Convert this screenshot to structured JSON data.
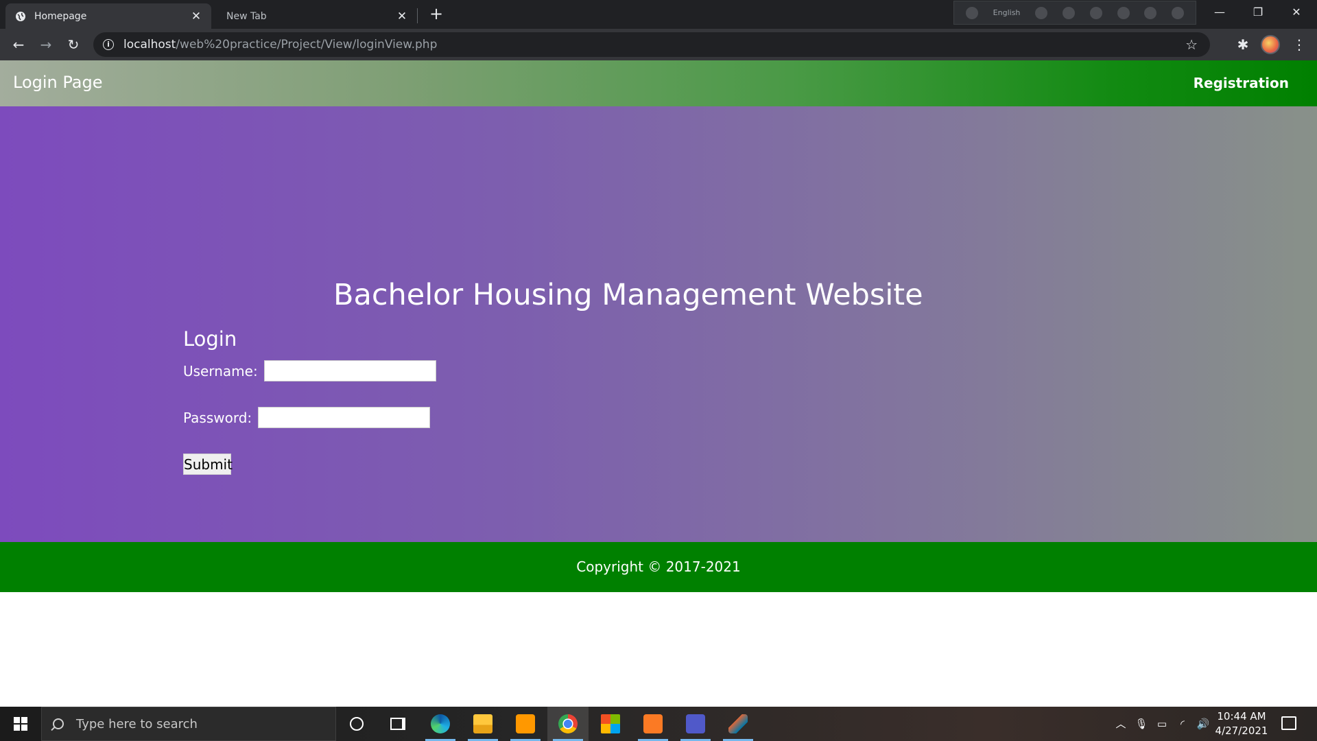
{
  "browser": {
    "tabs": [
      {
        "title": "Homepage",
        "active": true
      },
      {
        "title": "New Tab",
        "active": false
      }
    ],
    "extension_strip": {
      "language": "English"
    },
    "address": {
      "host": "localhost",
      "path": "/web%20practice/Project/View/loginView.php"
    }
  },
  "header": {
    "brand": "Login Page",
    "registration_link": "Registration"
  },
  "main": {
    "site_title": "Bachelor Housing Management Website",
    "login_heading": "Login",
    "username_label": "Username:",
    "username_value": "",
    "password_label": "Password:",
    "password_value": "",
    "submit_label": "Submit"
  },
  "footer": {
    "copyright": "Copyright © 2017-2021"
  },
  "taskbar": {
    "search_placeholder": "Type here to search",
    "time": "10:44 AM",
    "date": "4/27/2021",
    "apps": [
      "cortana",
      "task-view",
      "edge",
      "file-explorer",
      "sublime-text",
      "chrome",
      "microsoft-store",
      "xampp",
      "teams",
      "matlab"
    ]
  },
  "colors": {
    "header_gradient_end": "#008000",
    "hero_gradient_start": "#7d4bbd",
    "footer_bg": "#008000"
  }
}
